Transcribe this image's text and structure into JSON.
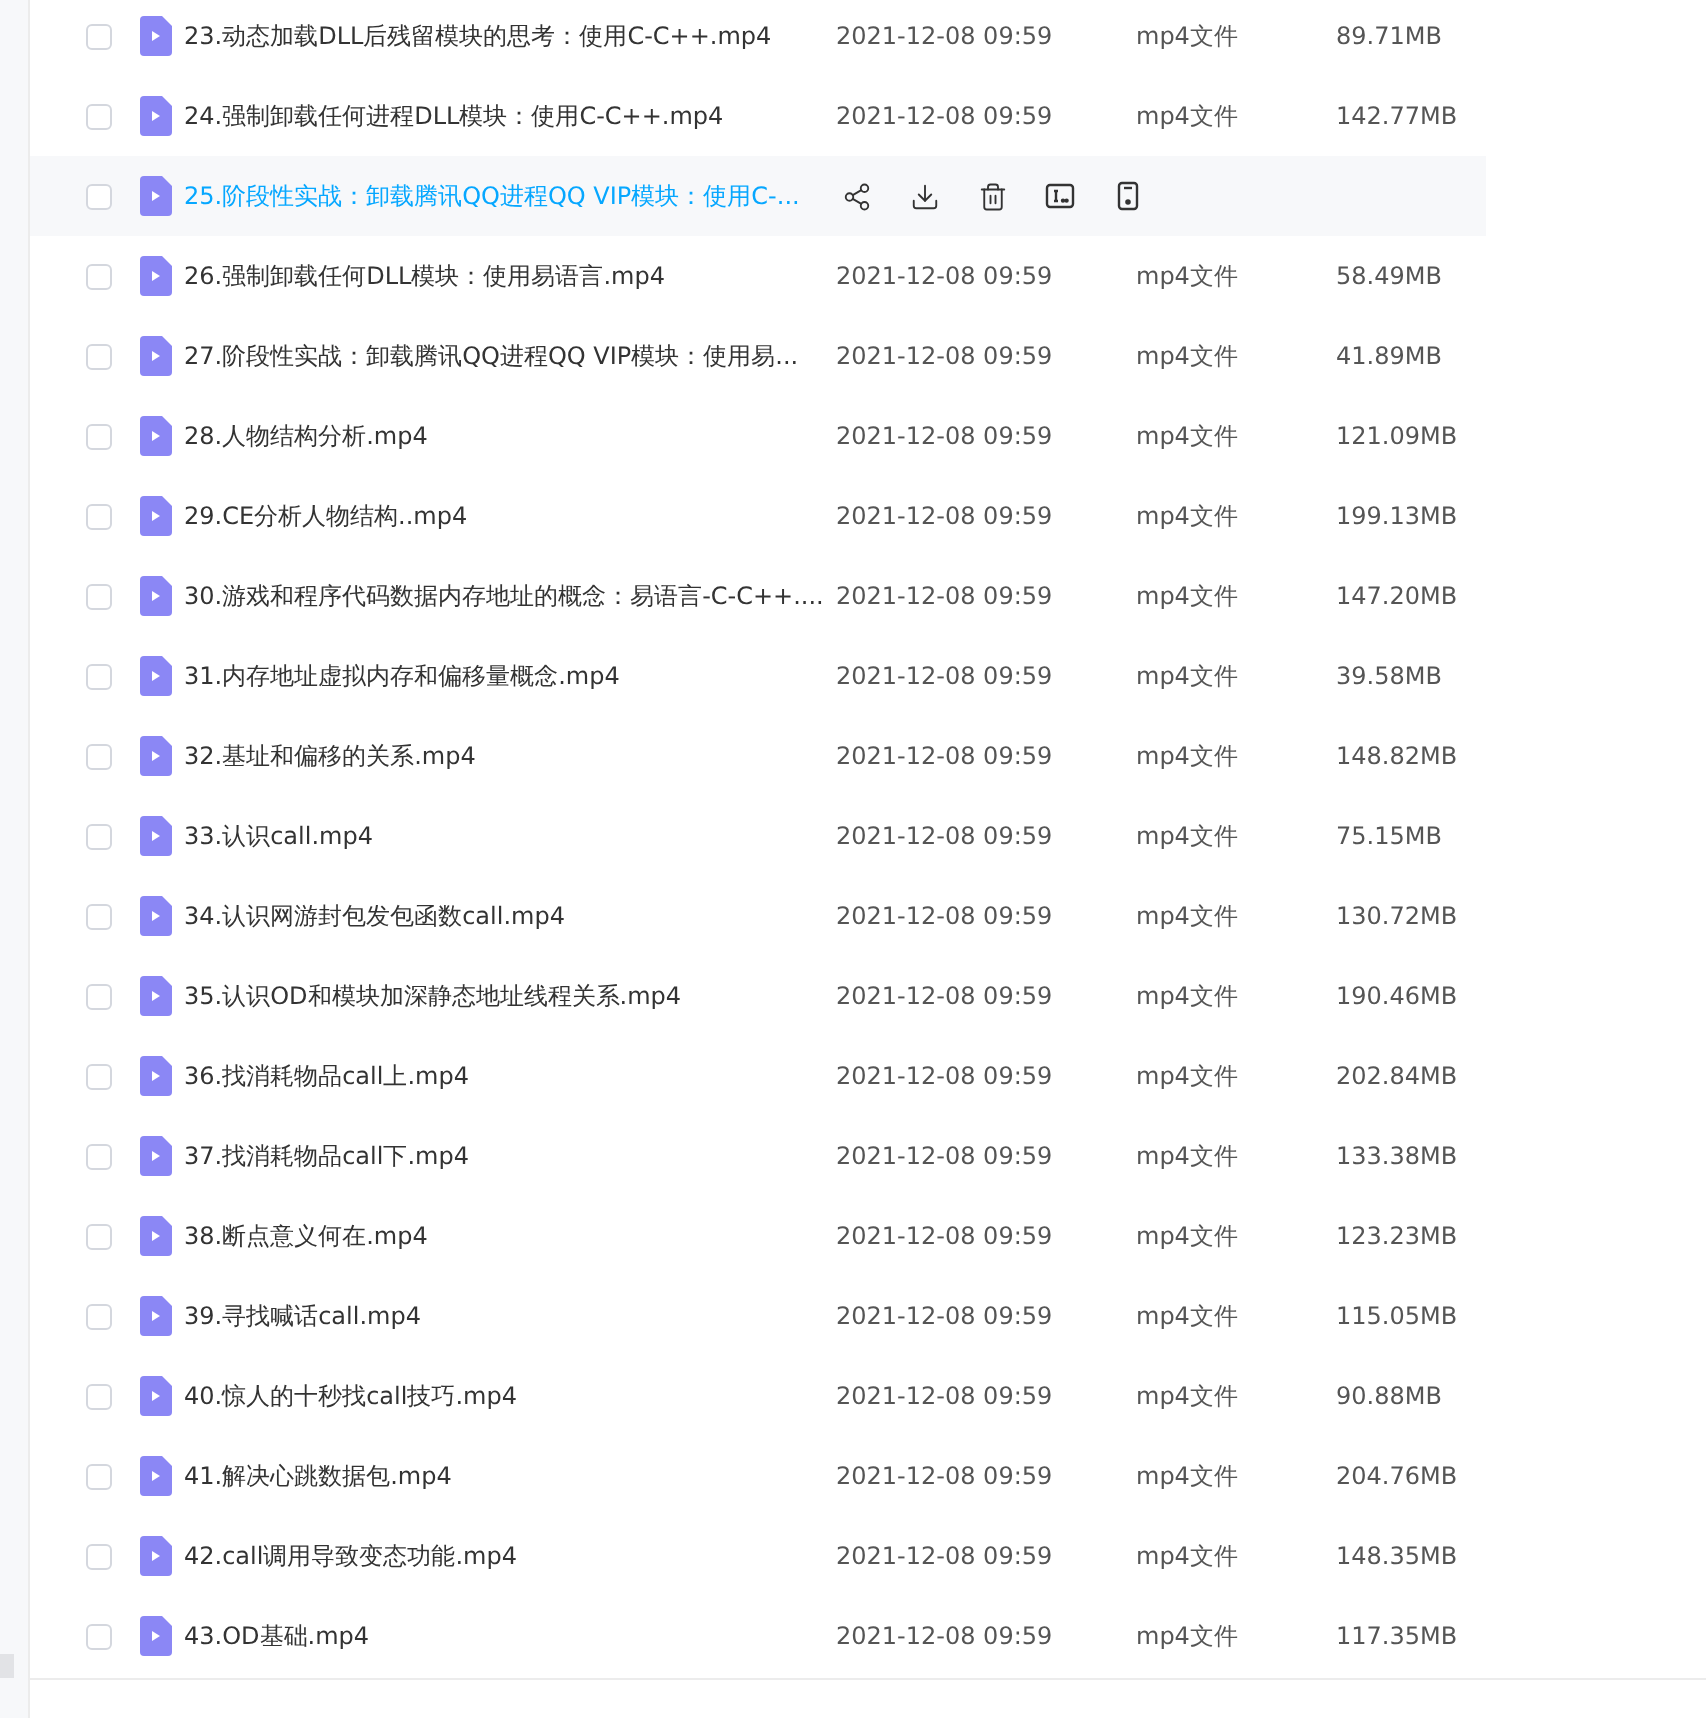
{
  "files": [
    {
      "name": "23.动态加载DLL后残留模块的思考：使用C-C++.mp4",
      "date": "2021-12-08 09:59",
      "type": "mp4文件",
      "size": "89.71MB",
      "hovered": false,
      "checked": false
    },
    {
      "name": "24.强制卸载任何进程DLL模块：使用C-C++.mp4",
      "date": "2021-12-08 09:59",
      "type": "mp4文件",
      "size": "142.77MB",
      "hovered": false,
      "checked": false
    },
    {
      "name": "25.阶段性实战：卸载腾讯QQ进程QQ VIP模块：使用C-...",
      "hovered": true,
      "checked": false
    },
    {
      "name": "26.强制卸载任何DLL模块：使用易语言.mp4",
      "date": "2021-12-08 09:59",
      "type": "mp4文件",
      "size": "58.49MB",
      "hovered": false,
      "checked": false
    },
    {
      "name": "27.阶段性实战：卸载腾讯QQ进程QQ VIP模块：使用易...",
      "date": "2021-12-08 09:59",
      "type": "mp4文件",
      "size": "41.89MB",
      "hovered": false,
      "checked": false
    },
    {
      "name": "28.人物结构分析.mp4",
      "date": "2021-12-08 09:59",
      "type": "mp4文件",
      "size": "121.09MB",
      "hovered": false,
      "checked": false
    },
    {
      "name": "29.CE分析人物结构..mp4",
      "date": "2021-12-08 09:59",
      "type": "mp4文件",
      "size": "199.13MB",
      "hovered": false,
      "checked": false
    },
    {
      "name": "30.游戏和程序代码数据内存地址的概念：易语言-C-C++....",
      "date": "2021-12-08 09:59",
      "type": "mp4文件",
      "size": "147.20MB",
      "hovered": false,
      "checked": false
    },
    {
      "name": "31.内存地址虚拟内存和偏移量概念.mp4",
      "date": "2021-12-08 09:59",
      "type": "mp4文件",
      "size": "39.58MB",
      "hovered": false,
      "checked": false
    },
    {
      "name": "32.基址和偏移的关系.mp4",
      "date": "2021-12-08 09:59",
      "type": "mp4文件",
      "size": "148.82MB",
      "hovered": false,
      "checked": false
    },
    {
      "name": "33.认识call.mp4",
      "date": "2021-12-08 09:59",
      "type": "mp4文件",
      "size": "75.15MB",
      "hovered": false,
      "checked": false
    },
    {
      "name": "34.认识网游封包发包函数call.mp4",
      "date": "2021-12-08 09:59",
      "type": "mp4文件",
      "size": "130.72MB",
      "hovered": false,
      "checked": false
    },
    {
      "name": "35.认识OD和模块加深静态地址线程关系.mp4",
      "date": "2021-12-08 09:59",
      "type": "mp4文件",
      "size": "190.46MB",
      "hovered": false,
      "checked": false
    },
    {
      "name": "36.找消耗物品call上.mp4",
      "date": "2021-12-08 09:59",
      "type": "mp4文件",
      "size": "202.84MB",
      "hovered": false,
      "checked": false
    },
    {
      "name": "37.找消耗物品call下.mp4",
      "date": "2021-12-08 09:59",
      "type": "mp4文件",
      "size": "133.38MB",
      "hovered": false,
      "checked": false
    },
    {
      "name": "38.断点意义何在.mp4",
      "date": "2021-12-08 09:59",
      "type": "mp4文件",
      "size": "123.23MB",
      "hovered": false,
      "checked": false
    },
    {
      "name": "39.寻找喊话call.mp4",
      "date": "2021-12-08 09:59",
      "type": "mp4文件",
      "size": "115.05MB",
      "hovered": false,
      "checked": false
    },
    {
      "name": "40.惊人的十秒找call技巧.mp4",
      "date": "2021-12-08 09:59",
      "type": "mp4文件",
      "size": "90.88MB",
      "hovered": false,
      "checked": false
    },
    {
      "name": "41.解决心跳数据包.mp4",
      "date": "2021-12-08 09:59",
      "type": "mp4文件",
      "size": "204.76MB",
      "hovered": false,
      "checked": false
    },
    {
      "name": "42.call调用导致变态功能.mp4",
      "date": "2021-12-08 09:59",
      "type": "mp4文件",
      "size": "148.35MB",
      "hovered": false,
      "checked": false
    },
    {
      "name": "43.OD基础.mp4",
      "date": "2021-12-08 09:59",
      "type": "mp4文件",
      "size": "117.35MB",
      "hovered": false,
      "checked": false
    }
  ]
}
